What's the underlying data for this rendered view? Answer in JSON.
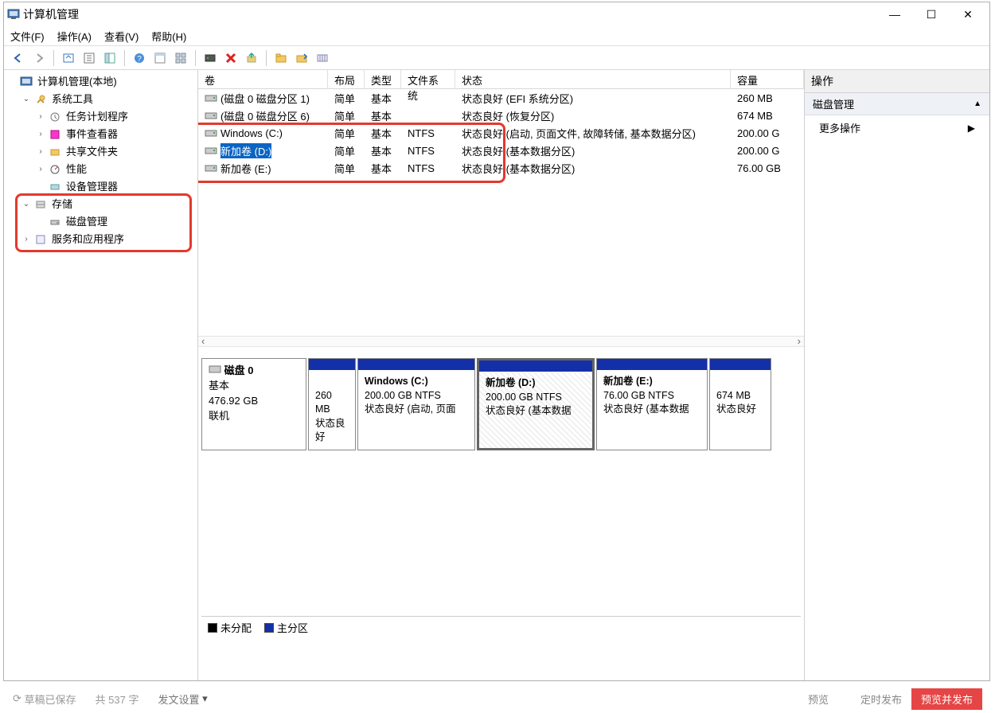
{
  "window": {
    "title": "计算机管理"
  },
  "menu": {
    "file": "文件(F)",
    "action": "操作(A)",
    "view": "查看(V)",
    "help": "帮助(H)"
  },
  "tree": {
    "root": "计算机管理(本地)",
    "system_tools": "系统工具",
    "task_scheduler": "任务计划程序",
    "event_viewer": "事件查看器",
    "shared_folders": "共享文件夹",
    "performance": "性能",
    "device_manager": "设备管理器",
    "storage": "存储",
    "disk_management": "磁盘管理",
    "services": "服务和应用程序"
  },
  "columns": {
    "volume": "卷",
    "layout": "布局",
    "type": "类型",
    "fs": "文件系统",
    "status": "状态",
    "capacity": "容量"
  },
  "volumes": [
    {
      "name": "(磁盘 0 磁盘分区 1)",
      "layout": "简单",
      "type": "基本",
      "fs": "",
      "status": "状态良好 (EFI 系统分区)",
      "capacity": "260 MB"
    },
    {
      "name": "(磁盘 0 磁盘分区 6)",
      "layout": "简单",
      "type": "基本",
      "fs": "",
      "status": "状态良好 (恢复分区)",
      "capacity": "674 MB"
    },
    {
      "name": "Windows  (C:)",
      "layout": "简单",
      "type": "基本",
      "fs": "NTFS",
      "status": "状态良好 (启动, 页面文件, 故障转储, 基本数据分区)",
      "capacity": "200.00 G"
    },
    {
      "name": "新加卷 (D:)",
      "layout": "简单",
      "type": "基本",
      "fs": "NTFS",
      "status": "状态良好 (基本数据分区)",
      "capacity": "200.00 G"
    },
    {
      "name": "新加卷 (E:)",
      "layout": "简单",
      "type": "基本",
      "fs": "NTFS",
      "status": "状态良好 (基本数据分区)",
      "capacity": "76.00 GB"
    }
  ],
  "disk": {
    "name": "磁盘 0",
    "type": "基本",
    "size": "476.92 GB",
    "state": "联机",
    "parts": [
      {
        "name": "",
        "line2": "260 MB",
        "line3": "状态良好"
      },
      {
        "name": "Windows   (C:)",
        "line2": "200.00 GB NTFS",
        "line3": "状态良好 (启动, 页面"
      },
      {
        "name": "新加卷   (D:)",
        "line2": "200.00 GB NTFS",
        "line3": "状态良好 (基本数据"
      },
      {
        "name": "新加卷  (E:)",
        "line2": "76.00 GB NTFS",
        "line3": "状态良好 (基本数据"
      },
      {
        "name": "",
        "line2": "674 MB",
        "line3": "状态良好"
      }
    ]
  },
  "legend": {
    "unalloc": "未分配",
    "primary": "主分区"
  },
  "actions": {
    "header": "操作",
    "section": "磁盘管理",
    "more": "更多操作"
  },
  "footer": {
    "saved": "草稿已保存",
    "count": "共 537 字",
    "setting": "发文设置",
    "preview": "预览",
    "schedule": "定时发布",
    "publish": "预览并发布"
  }
}
